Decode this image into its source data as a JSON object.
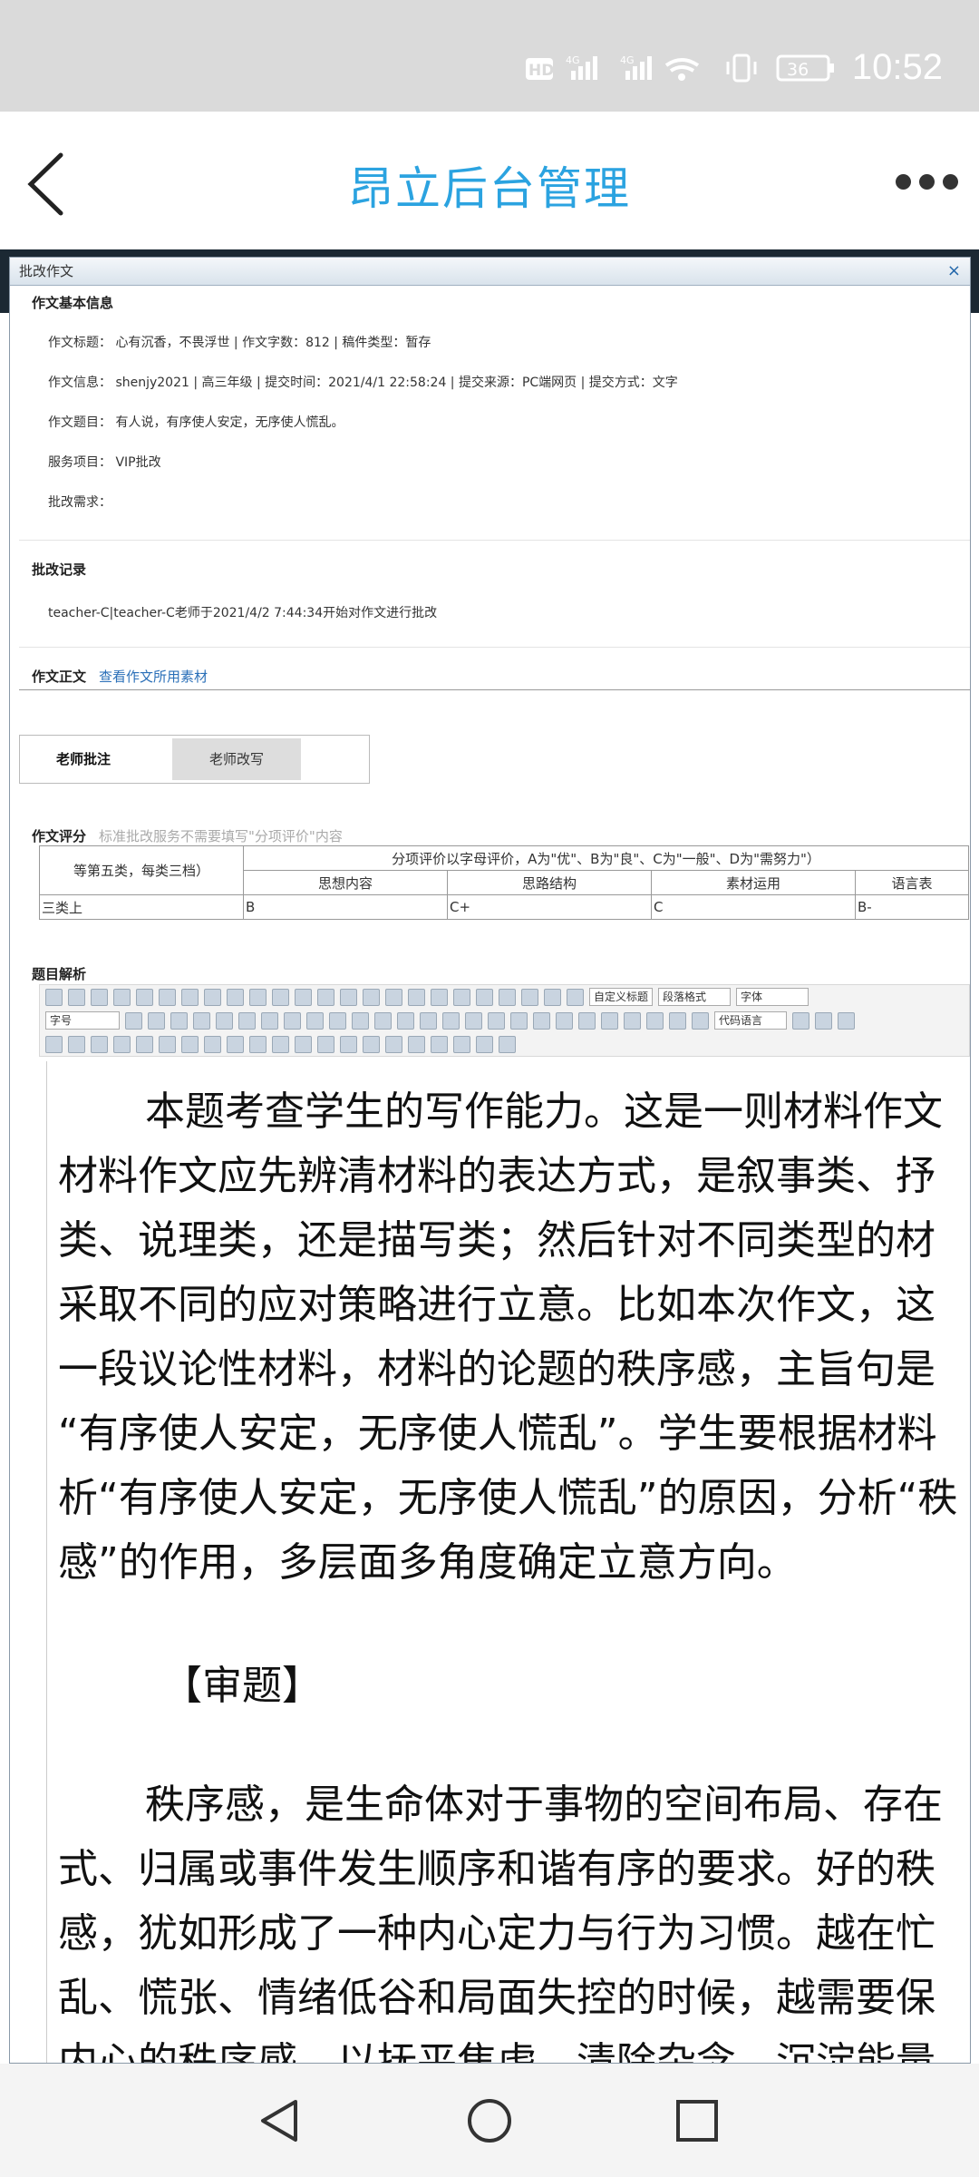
{
  "status_bar": {
    "time": "10:52",
    "battery": "36",
    "signal_labels": [
      "HD",
      "4G",
      "4G"
    ]
  },
  "app": {
    "title": "昂立后台管理"
  },
  "dialog": {
    "title": "批改作文",
    "close": "×",
    "basic_section": "作文基本信息",
    "info": [
      "作文标题：  心有沉香，不畏浮世 | 作文字数：812 | 稿件类型：暂存",
      "作文信息：  shenjy2021 | 高三年级 | 提交时间：2021/4/1 22:58:24 | 提交来源：PC端网页 | 提交方式：文字",
      "作文题目：  有人说，有序使人安定，无序使人慌乱。",
      "服务项目：  VIP批改",
      "批改需求："
    ],
    "record_section": "批改记录",
    "record_text": "teacher-C|teacher-C老师于2021/4/2 7:44:34开始对作文进行批改",
    "essay_section": "作文正文",
    "essay_link": "查看作文所用素材",
    "tabs": [
      "老师批注",
      "老师改写"
    ],
    "score_section": "作文评分",
    "score_hint": "标准批改服务不需要填写\"分项评价\"内容",
    "score_table": {
      "tier_header": "等第五类，每类三档）",
      "criteria_header": "分项评价以字母评价，A为\"优\"、B为\"良\"、C为\"一般\"、D为\"需努力\"）",
      "columns": [
        "思想内容",
        "思路结构",
        "素材运用",
        "语言表"
      ],
      "values": [
        "三类上",
        "B",
        "C+",
        "C",
        "B-"
      ]
    },
    "analysis_section": "题目解析",
    "toolbar": {
      "font_size": "字号",
      "custom_title": "自定义标题",
      "paragraph": "段落格式",
      "font": "字体",
      "code_lang": "代码语言"
    },
    "content": [
      "本题考查学生的写作能力。这是一则材料作文",
      "材料作文应先辨清材料的表达方式，是叙事类、抒",
      "类、说理类，还是描写类；然后针对不同类型的材",
      "采取不同的应对策略进行立意。比如本次作文，这",
      "一段议论性材料，材料的论题的秩序感，主旨句是",
      "“有序使人安定，无序使人慌乱”。学生要根据材料",
      "析“有序使人安定，无序使人慌乱”的原因，分析“秩",
      "感”的作用，多层面多角度确定立意方向。"
    ],
    "heading": "【审题】",
    "content2": [
      "秩序感，是生命体对于事物的空间布局、存在",
      "式、归属或事件发生顺序和谐有序的要求。好的秩",
      "感，犹如形成了一种内心定力与行为习惯。越在忙",
      "乱、慌张、情绪低谷和局面失控的时候，越需要保",
      "内心的秩序感，以抚平焦虑、清除杂念、沉淀能量"
    ]
  }
}
